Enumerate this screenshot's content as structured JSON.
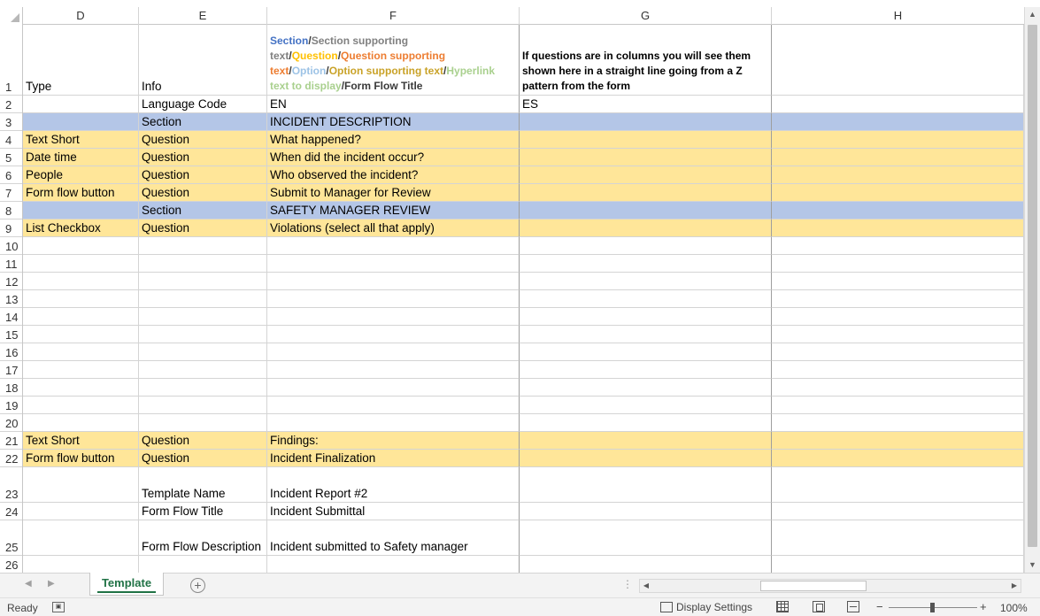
{
  "columns": [
    "D",
    "E",
    "F",
    "G",
    "H"
  ],
  "header_row": {
    "number": "1",
    "d": "Type",
    "e": "Info",
    "f_legend": [
      {
        "text": "Section",
        "class": "c-section"
      },
      {
        "text": "/",
        "class": "c-dark"
      },
      {
        "text": "Section supporting text",
        "class": "c-sectxt"
      },
      {
        "text": "/",
        "class": "c-dark"
      },
      {
        "text": "Question",
        "class": "c-question"
      },
      {
        "text": "/",
        "class": "c-dark"
      },
      {
        "text": "Question supporting text",
        "class": "c-qtxt"
      },
      {
        "text": "/",
        "class": "c-dark"
      },
      {
        "text": "Option",
        "class": "c-option"
      },
      {
        "text": "/",
        "class": "c-dark"
      },
      {
        "text": "Option supporting text",
        "class": "c-opttxt"
      },
      {
        "text": "/",
        "class": "c-dark"
      },
      {
        "text": "Hyperlink text to display",
        "class": "c-link"
      },
      {
        "text": "/Form Flow Title",
        "class": "c-dark"
      }
    ],
    "g": "If questions are in columns you will see them shown here in a straight line going from a Z pattern from the form",
    "h": ""
  },
  "rows": [
    {
      "num": "2",
      "d": "",
      "e": "Language Code",
      "f": "EN",
      "g": "ES",
      "h": "",
      "fill": ""
    },
    {
      "num": "3",
      "d": "",
      "e": "Section",
      "f": "INCIDENT DESCRIPTION",
      "g": "",
      "h": "",
      "fill": "section"
    },
    {
      "num": "4",
      "d": "Text Short",
      "e": "Question",
      "f": "What happened?",
      "g": "",
      "h": "",
      "fill": "question"
    },
    {
      "num": "5",
      "d": "Date time",
      "e": "Question",
      "f": "When did the incident occur?",
      "g": "",
      "h": "",
      "fill": "question"
    },
    {
      "num": "6",
      "d": "People",
      "e": "Question",
      "f": "Who observed the incident?",
      "g": "",
      "h": "",
      "fill": "question"
    },
    {
      "num": "7",
      "d": "Form flow button",
      "e": "Question",
      "f": "Submit to Manager for Review",
      "g": "",
      "h": "",
      "fill": "question"
    },
    {
      "num": "8",
      "d": "",
      "e": "Section",
      "f": "SAFETY MANAGER REVIEW",
      "g": "",
      "h": "",
      "fill": "section"
    },
    {
      "num": "9",
      "d": "List Checkbox",
      "e": "Question",
      "f": "Violations (select all that apply)",
      "g": "",
      "h": "",
      "fill": "question"
    },
    {
      "num": "10",
      "d": "",
      "e": "",
      "f": "",
      "g": "",
      "h": "",
      "fill": ""
    },
    {
      "num": "11",
      "d": "",
      "e": "",
      "f": "",
      "g": "",
      "h": "",
      "fill": ""
    },
    {
      "num": "12",
      "d": "",
      "e": "",
      "f": "",
      "g": "",
      "h": "",
      "fill": ""
    },
    {
      "num": "13",
      "d": "",
      "e": "",
      "f": "",
      "g": "",
      "h": "",
      "fill": ""
    },
    {
      "num": "14",
      "d": "",
      "e": "",
      "f": "",
      "g": "",
      "h": "",
      "fill": ""
    },
    {
      "num": "15",
      "d": "",
      "e": "",
      "f": "",
      "g": "",
      "h": "",
      "fill": ""
    },
    {
      "num": "16",
      "d": "",
      "e": "",
      "f": "",
      "g": "",
      "h": "",
      "fill": ""
    },
    {
      "num": "17",
      "d": "",
      "e": "",
      "f": "",
      "g": "",
      "h": "",
      "fill": ""
    },
    {
      "num": "18",
      "d": "",
      "e": "",
      "f": "",
      "g": "",
      "h": "",
      "fill": ""
    },
    {
      "num": "19",
      "d": "",
      "e": "",
      "f": "",
      "g": "",
      "h": "",
      "fill": ""
    },
    {
      "num": "20",
      "d": "",
      "e": "",
      "f": "",
      "g": "",
      "h": "",
      "fill": ""
    },
    {
      "num": "21",
      "d": "Text Short",
      "e": "Question",
      "f": "Findings:",
      "g": "",
      "h": "",
      "fill": "question"
    },
    {
      "num": "22",
      "d": "Form flow button",
      "e": "Question",
      "f": "Incident Finalization",
      "g": "",
      "h": "",
      "fill": "question"
    },
    {
      "num": "23",
      "d": "",
      "e": "Template Name",
      "f": "Incident Report #2",
      "g": "",
      "h": "",
      "fill": ""
    },
    {
      "num": "24",
      "d": "",
      "e": "Form Flow Title",
      "f": "Incident Submittal",
      "g": "",
      "h": "",
      "fill": ""
    },
    {
      "num": "25",
      "d": "",
      "e": "Form Flow Description",
      "f": "Incident submitted to Safety manager",
      "g": "",
      "h": "",
      "fill": ""
    },
    {
      "num": "26",
      "d": "",
      "e": "",
      "f": "",
      "g": "",
      "h": "",
      "fill": ""
    }
  ],
  "sheet_tab": "Template",
  "status": {
    "ready": "Ready",
    "display_settings": "Display Settings",
    "zoom_minus": "−",
    "zoom_plus": "+",
    "zoom": "100%"
  },
  "colors": {
    "section_fill": "#b4c6e7",
    "question_fill": "#ffe699",
    "accent": "#217346"
  }
}
